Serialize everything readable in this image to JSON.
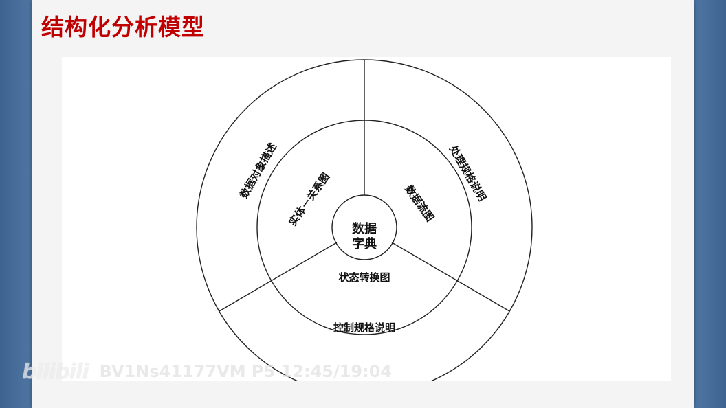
{
  "slide": {
    "title": "结构化分析模型",
    "title_color": "#c00000",
    "background_color": "#f4f4f4"
  },
  "diagram": {
    "center": {
      "line1": "数据",
      "line2": "字典"
    },
    "middle_ring": {
      "left": "实体－关系图",
      "right": "数据流图",
      "bottom": "状态转换图"
    },
    "outer_ring": {
      "left": "数据对象描述",
      "right": "处理规格说明",
      "bottom": "控制规格说明"
    }
  },
  "watermark": {
    "logo": "bilibili",
    "text": "BV1Ns41177VM P5 12:45/19:04"
  }
}
